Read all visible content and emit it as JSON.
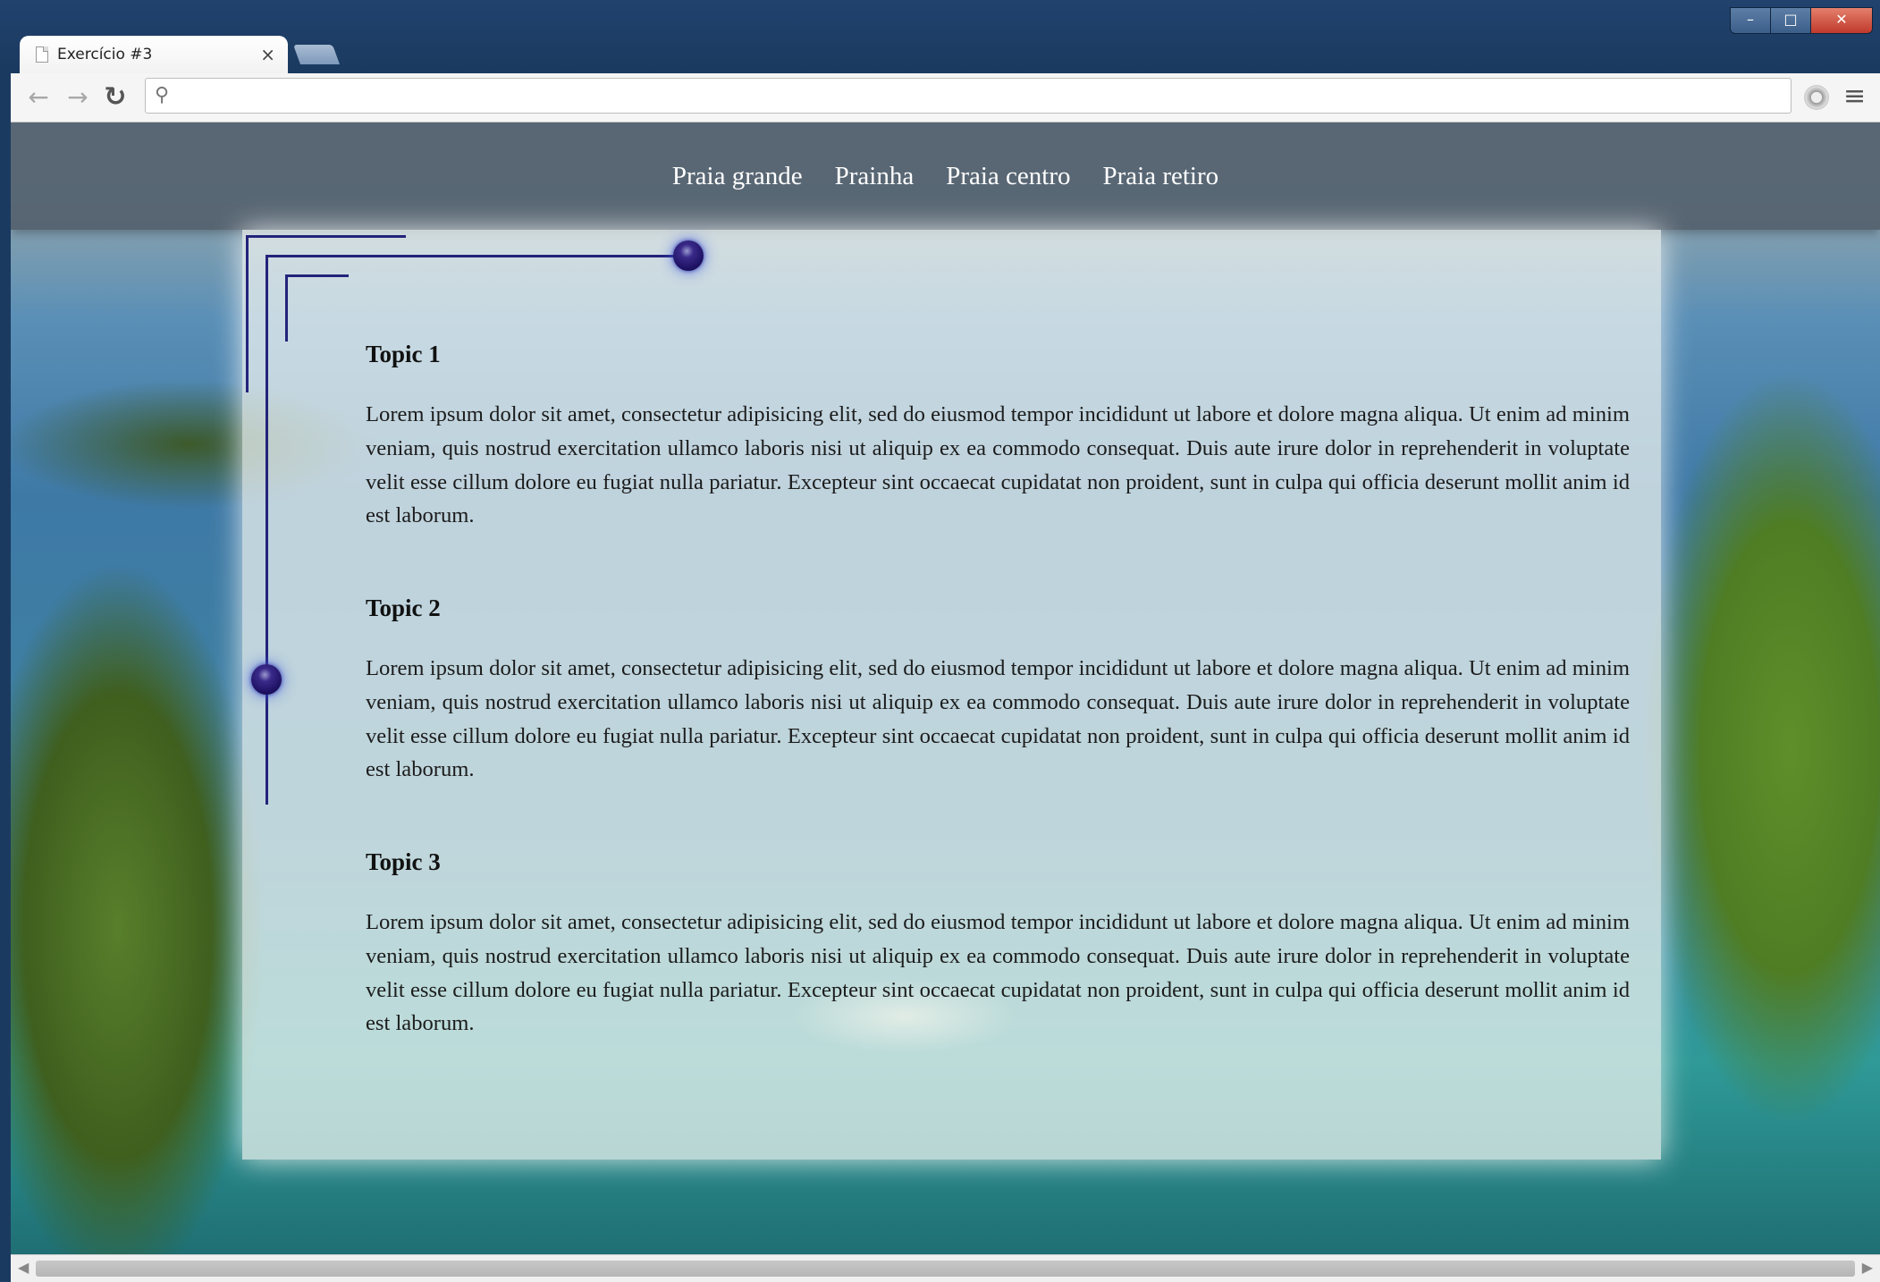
{
  "browser": {
    "tab_title": "Exercício #3",
    "tab_close_glyph": "×",
    "window_controls": {
      "minimize": "–",
      "maximize": "□",
      "close": "✕"
    },
    "address_value": "",
    "icons": [
      "back-icon",
      "forward-icon",
      "reload-icon",
      "search-icon",
      "extension-icon",
      "menu-icon"
    ]
  },
  "nav": {
    "items": [
      {
        "label": "Praia grande"
      },
      {
        "label": "Prainha"
      },
      {
        "label": "Praia centro"
      },
      {
        "label": "Praia retiro"
      }
    ]
  },
  "topics": [
    {
      "title": "Topic 1",
      "body": "Lorem ipsum dolor sit amet, consectetur adipisicing elit, sed do eiusmod tempor incididunt ut labore et dolore magna aliqua. Ut enim ad minim veniam, quis nostrud exercitation ullamco laboris nisi ut aliquip ex ea commodo consequat. Duis aute irure dolor in reprehenderit in voluptate velit esse cillum dolore eu fugiat nulla pariatur. Excepteur sint occaecat cupidatat non proident, sunt in culpa qui officia deserunt mollit anim id est laborum."
    },
    {
      "title": "Topic 2",
      "body": "Lorem ipsum dolor sit amet, consectetur adipisicing elit, sed do eiusmod tempor incididunt ut labore et dolore magna aliqua. Ut enim ad minim veniam, quis nostrud exercitation ullamco laboris nisi ut aliquip ex ea commodo consequat. Duis aute irure dolor in reprehenderit in voluptate velit esse cillum dolore eu fugiat nulla pariatur. Excepteur sint occaecat cupidatat non proident, sunt in culpa qui officia deserunt mollit anim id est laborum."
    },
    {
      "title": "Topic 3",
      "body": "Lorem ipsum dolor sit amet, consectetur adipisicing elit, sed do eiusmod tempor incididunt ut labore et dolore magna aliqua. Ut enim ad minim veniam, quis nostrud exercitation ullamco laboris nisi ut aliquip ex ea commodo consequat. Duis aute irure dolor in reprehenderit in voluptate velit esse cillum dolore eu fugiat nulla pariatur. Excepteur sint occaecat cupidatat non proident, sunt in culpa qui officia deserunt mollit anim id est laborum."
    }
  ],
  "colors": {
    "navbar_bg": "#54626e",
    "deco_line": "#23237a",
    "panel_bg": "#f1f5f2"
  }
}
